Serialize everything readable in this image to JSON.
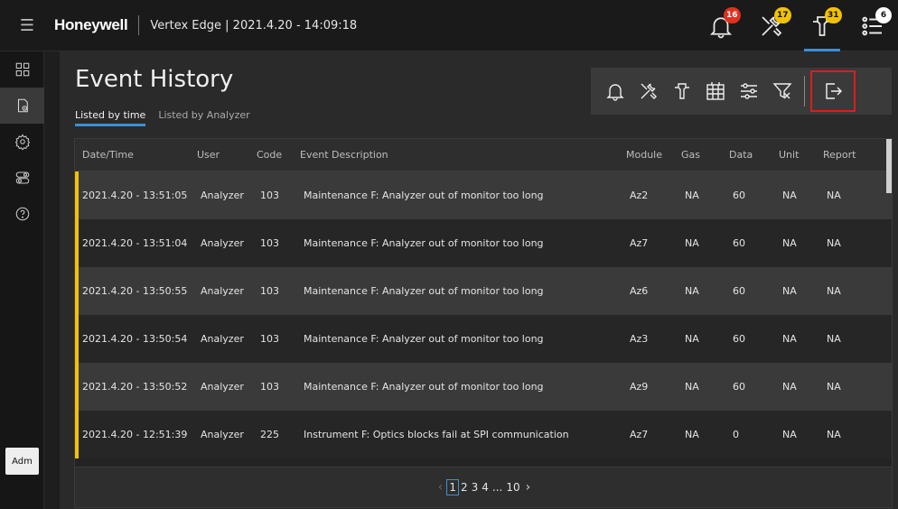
{
  "header": {
    "menu_icon": "hamburger-icon",
    "brand": "Honeywell",
    "app_title": "Vertex Edge | 2021.4.20 - 14:09:18",
    "icons": [
      {
        "name": "alarm-bell-icon",
        "badge": "16",
        "badge_color": "#e0301e"
      },
      {
        "name": "maintenance-tools-icon",
        "badge": "17",
        "badge_color": "#f2c200"
      },
      {
        "name": "instrument-fault-icon",
        "badge": "31",
        "badge_color": "#f2c200"
      },
      {
        "name": "event-list-icon",
        "badge": "6",
        "badge_color": "#ffffff"
      }
    ]
  },
  "sidebar": {
    "items": [
      "dashboard-icon",
      "event-history-icon",
      "settings-icon",
      "toggle-icon",
      "help-icon"
    ],
    "avatar_label": "Adm"
  },
  "page": {
    "title": "Event History",
    "tabs": [
      {
        "label": "Listed by time",
        "active": true
      },
      {
        "label": "Listed by Analyzer",
        "active": false
      }
    ]
  },
  "toolbar": {
    "icons": [
      "filter-alarm-icon",
      "filter-maintenance-icon",
      "filter-instrument-icon",
      "filter-calendar-icon",
      "filter-settings-icon",
      "clear-filter-icon",
      "export-icon"
    ]
  },
  "table": {
    "columns": [
      "Date/Time",
      "User",
      "Code",
      "Event Description",
      "Module",
      "Gas",
      "Data",
      "Unit",
      "Report"
    ],
    "rows": [
      [
        "2021.4.20 - 13:51:05",
        "Analyzer",
        "103",
        "Maintenance F: Analyzer out of monitor too long",
        "Az2",
        "NA",
        "60",
        "NA",
        "NA"
      ],
      [
        "2021.4.20 - 13:51:04",
        "Analyzer",
        "103",
        "Maintenance F: Analyzer out of monitor too long",
        "Az7",
        "NA",
        "60",
        "NA",
        "NA"
      ],
      [
        "2021.4.20 - 13:50:55",
        "Analyzer",
        "103",
        "Maintenance F: Analyzer out of monitor too long",
        "Az6",
        "NA",
        "60",
        "NA",
        "NA"
      ],
      [
        "2021.4.20 - 13:50:54",
        "Analyzer",
        "103",
        "Maintenance F: Analyzer out of monitor too long",
        "Az3",
        "NA",
        "60",
        "NA",
        "NA"
      ],
      [
        "2021.4.20 - 13:50:52",
        "Analyzer",
        "103",
        "Maintenance F: Analyzer out of monitor too long",
        "Az9",
        "NA",
        "60",
        "NA",
        "NA"
      ],
      [
        "2021.4.20 - 12:51:39",
        "Analyzer",
        "225",
        "Instrument F: Optics blocks fail at SPI communication",
        "Az7",
        "NA",
        "0",
        "NA",
        "NA"
      ]
    ],
    "row_marker_color": "#f2c200"
  },
  "pagination": {
    "prev": "‹",
    "pages": [
      "1",
      "2",
      "3",
      "4",
      "...",
      "10"
    ],
    "current": "1",
    "next": "›"
  },
  "colors": {
    "accent": "#3d8fd6",
    "highlight_box": "#e01b1b"
  }
}
